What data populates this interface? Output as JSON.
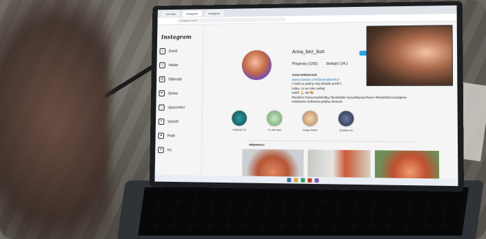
{
  "browser": {
    "tabs": [
      "YouTube",
      "Instagram",
      "Instagram"
    ],
    "url": "instagram.com"
  },
  "instagram": {
    "logo": "Instagram",
    "nav": [
      {
        "label": "Domů",
        "icon": "home-icon"
      },
      {
        "label": "Hledat",
        "icon": "search-icon"
      },
      {
        "label": "Objevujte",
        "icon": "compass-icon"
      },
      {
        "label": "Zprávy",
        "icon": "send-icon"
      },
      {
        "label": "Upozornění",
        "icon": "heart-icon"
      },
      {
        "label": "Vytvořit",
        "icon": "plus-icon"
      },
      {
        "label": "Profil",
        "icon": "avatar-icon"
      },
      {
        "label": "Víc",
        "icon": "menu-icon"
      }
    ],
    "profile": {
      "username": "Anna_bez_iluzi",
      "follow_label": "",
      "posts": "Příspěvky (1250)",
      "followers": "Sledující (34,1",
      "bio_name": "Anna Urbancová",
      "bio_link": "www.youtube.com/@annabeziluzi",
      "bio_lines": [
        "!! tohle je jediný můj oficiální profil !!",
        "holka, co se toho nebojí",
        "zadrž 🙏 ale 🎨",
        "#beziluzi #zanormalniholky #bossbabe #yourlifeyourchoice #best2022cozazijeme"
      ],
      "bio_tag": "minibiutnic kniharina pitidha liminest"
    },
    "highlights": [
      "Cesta je cíl",
      "Tu mě baví",
      "Canjo Deen",
      "Zvonka víc"
    ],
    "content_tabs": [
      "PŘÍSPĚVKY",
      "",
      ""
    ]
  }
}
